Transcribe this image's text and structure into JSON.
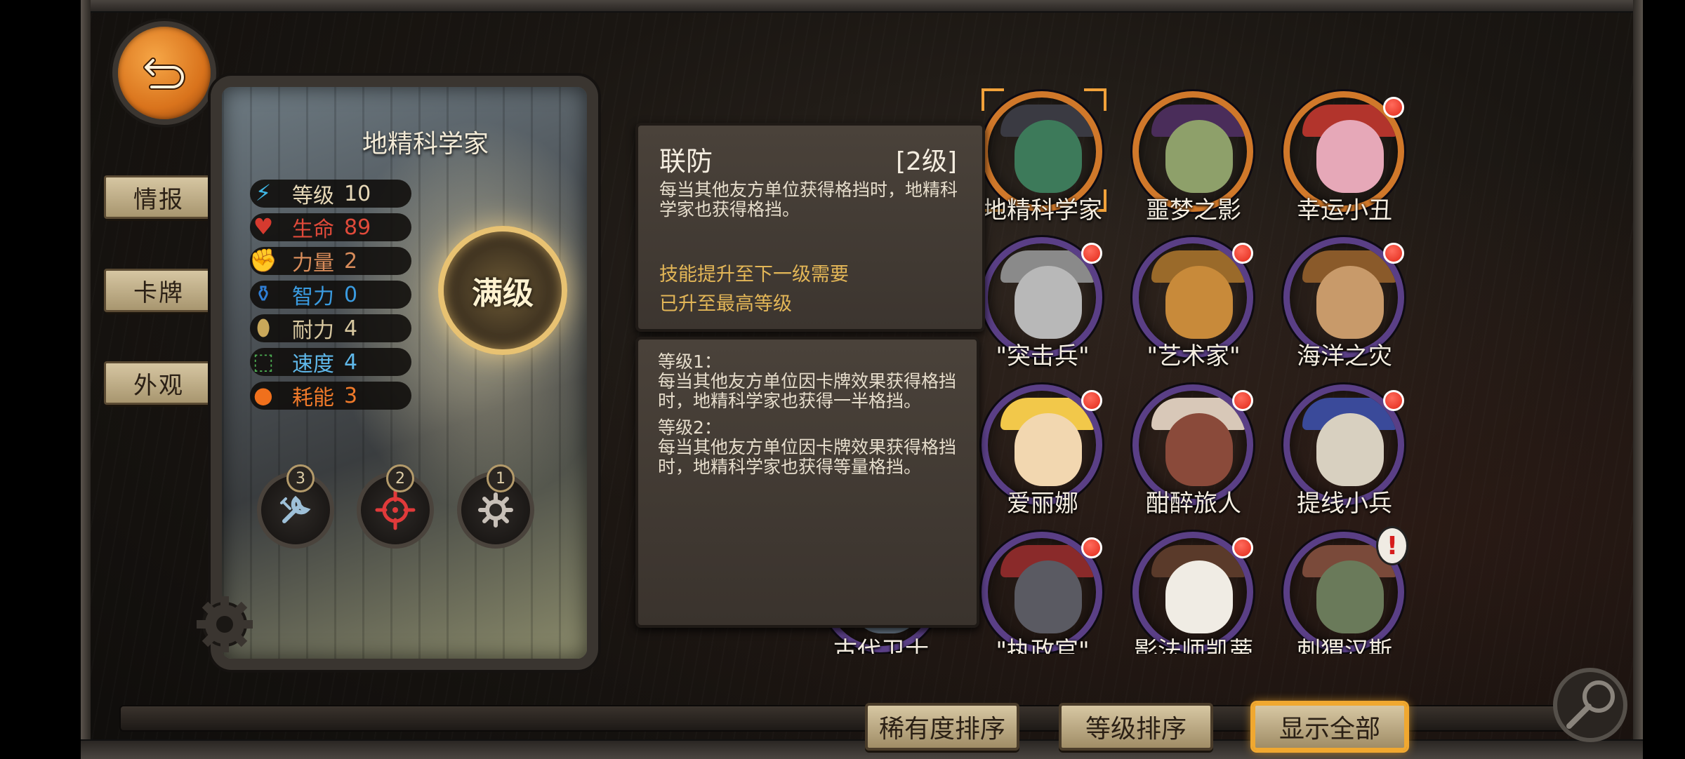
{
  "character": {
    "name": "地精科学家",
    "max_badge": "满级",
    "stats": [
      {
        "label": "等级",
        "value": "10",
        "color": "#e8d9b8",
        "icon": "lightning-icon",
        "glyph": "⚡",
        "iconColor": "#3fb8e6"
      },
      {
        "label": "生命",
        "value": "89",
        "color": "#e04a3a",
        "icon": "heart-icon",
        "glyph": "♥",
        "iconColor": "#d63a2f"
      },
      {
        "label": "力量",
        "value": "2",
        "color": "#d88c5a",
        "icon": "fist-icon",
        "glyph": "✊",
        "iconColor": "#c25a3a"
      },
      {
        "label": "智力",
        "value": "0",
        "color": "#3a9be0",
        "icon": "potion-icon",
        "glyph": "⚱",
        "iconColor": "#2f7fd6"
      },
      {
        "label": "耐力",
        "value": "4",
        "color": "#d8c8a0",
        "icon": "shield-icon",
        "glyph": "⬮",
        "iconColor": "#c9a85a"
      },
      {
        "label": "速度",
        "value": "4",
        "color": "#5fb8ea",
        "icon": "boot-icon",
        "glyph": "⬚",
        "iconColor": "#4cae52"
      },
      {
        "label": "耗能",
        "value": "3",
        "color": "#f07a2a",
        "icon": "energy-orb-icon",
        "glyph": "●",
        "iconColor": "#f0701c"
      }
    ],
    "skills": [
      {
        "badge": "3",
        "icon": "wrench-icon"
      },
      {
        "badge": "2",
        "icon": "crosshair-icon"
      },
      {
        "badge": "1",
        "icon": "gear-icon"
      }
    ]
  },
  "side_tabs": [
    "情报",
    "卡牌",
    "外观"
  ],
  "tooltip": {
    "title": "联防",
    "level": "[2级]",
    "desc": "每当其他友方单位获得格挡时，地精科学家也获得格挡。",
    "upgrade_label": "技能提升至下一级需要",
    "upgrade_status": "已升至最高等级"
  },
  "detail": {
    "level1_title": "等级1：",
    "level1_text": "每当其他友方单位因卡牌效果获得格挡时，地精科学家也获得一半格挡。",
    "level2_title": "等级2：",
    "level2_text": "每当其他友方单位因卡牌效果获得格挡时，地精科学家也获得等量格挡。"
  },
  "roster": [
    {
      "name": "",
      "ring": "orange",
      "dot": true,
      "skin": "#6a5a9a",
      "hat": "#c8c8d8",
      "hidden": true
    },
    {
      "name": "地精科学家",
      "ring": "orange",
      "dot": false,
      "skin": "#3d7a5a",
      "hat": "#3a3a42",
      "selected": true
    },
    {
      "name": "噩梦之影",
      "ring": "orange",
      "dot": false,
      "skin": "#8ea06a",
      "hat": "#4a2d5a"
    },
    {
      "name": "幸运小丑",
      "ring": "orange",
      "dot": true,
      "skin": "#e6a8b8",
      "hat": "#b2342c"
    },
    {
      "name": "",
      "ring": "orange",
      "dot": false,
      "skin": "#c0485a",
      "hat": "#7a2a3a",
      "hidden": true
    },
    {
      "name": "\"突击兵\"",
      "ring": "purple",
      "dot": true,
      "skin": "#b8b8b8",
      "hat": "#8a8a8a"
    },
    {
      "name": "\"艺术家\"",
      "ring": "purple",
      "dot": true,
      "skin": "#c88a3a",
      "hat": "#9a6a2a"
    },
    {
      "name": "海洋之灾",
      "ring": "purple",
      "dot": true,
      "skin": "#c89a6a",
      "hat": "#8a5a2a"
    },
    {
      "name": "",
      "ring": "purple",
      "dot": false,
      "skin": "#888",
      "hat": "#555",
      "hidden": true
    },
    {
      "name": "爱丽娜",
      "ring": "purple",
      "dot": true,
      "skin": "#f2d7b0",
      "hat": "#f2c84a"
    },
    {
      "name": "酣醉旅人",
      "ring": "purple",
      "dot": true,
      "skin": "#8a4a3a",
      "hat": "#d8c8b8"
    },
    {
      "name": "提线小兵",
      "ring": "purple",
      "dot": true,
      "skin": "#d8d0c0",
      "hat": "#3a4a9a"
    },
    {
      "name": "古代卫士",
      "ring": "purple",
      "dot": false,
      "skin": "#6a7a8a",
      "hat": "#4a5a6a",
      "hidden": true
    },
    {
      "name": "\"执政官\"",
      "ring": "purple",
      "dot": true,
      "skin": "#5a5a62",
      "hat": "#8a2a2a"
    },
    {
      "name": "影法师凯蒂",
      "ring": "purple",
      "dot": true,
      "skin": "#f0ece4",
      "hat": "#5a3a2a"
    },
    {
      "name": "刺猬汉斯",
      "ring": "purple",
      "dot": false,
      "alert": true,
      "alert_glyph": "!",
      "skin": "#6a7a5a",
      "hat": "#7a4a3a"
    }
  ],
  "sort_buttons": [
    "稀有度排序",
    "等级排序",
    "显示全部"
  ],
  "colors": {
    "accent": "#f0a830",
    "tab_bg": "#d6c6a2",
    "back_button": "#e58a2e"
  }
}
